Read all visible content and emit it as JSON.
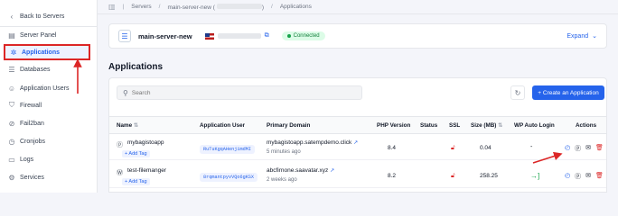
{
  "sidebar": {
    "items": [
      {
        "label": "Back to Servers",
        "icon": "chevron-left-icon",
        "glyph": "‹"
      },
      {
        "label": "Server Panel",
        "icon": "server-panel-icon",
        "glyph": "▤"
      },
      {
        "label": "Applications",
        "icon": "applications-icon",
        "glyph": "✲"
      },
      {
        "label": "Databases",
        "icon": "database-icon",
        "glyph": "☰"
      },
      {
        "label": "Application Users",
        "icon": "users-icon",
        "glyph": "☺"
      },
      {
        "label": "Firewall",
        "icon": "shield-icon",
        "glyph": "⛉"
      },
      {
        "label": "Fail2ban",
        "icon": "ban-icon",
        "glyph": "⊘"
      },
      {
        "label": "Cronjobs",
        "icon": "clock-icon",
        "glyph": "◷"
      },
      {
        "label": "Logs",
        "icon": "logs-icon",
        "glyph": "▭"
      },
      {
        "label": "Services",
        "icon": "services-icon",
        "glyph": "⚙"
      }
    ]
  },
  "breadcrumb": {
    "items": [
      "Servers",
      "main-server-new (",
      ")",
      "Applications"
    ]
  },
  "server": {
    "name": "main-server-new",
    "status": "Connected",
    "expand_label": "Expand"
  },
  "applications": {
    "title": "Applications",
    "search_placeholder": "Search",
    "create_label": "+ Create an Application",
    "columns": [
      "Name",
      "Application User",
      "Primary Domain",
      "PHP Version",
      "Status",
      "SSL",
      "Size (MB)",
      "WP Auto Login",
      "Actions"
    ],
    "rows": [
      {
        "name": "mybagistoapp",
        "add_tag": "+ Add Tag",
        "user": "RuTuKgqAHenjimdMI",
        "domain": "mybagistoapp.satempdemo.click",
        "time": "5 minutes ago",
        "php": "8.4",
        "size": "0.04",
        "wp_auto_login": "-"
      },
      {
        "name": "test-filemanger",
        "add_tag": "+ Add Tag",
        "user": "8rqmantpyvVQo6gKSX",
        "domain": "abcfirnone.saavatar.xyz",
        "time": "2 weeks ago",
        "php": "8.2",
        "size": "258.25",
        "wp_auto_login": "→]"
      }
    ]
  },
  "colors": {
    "accent": "#2563eb",
    "annotation": "#dc2626",
    "connected": "#15803d"
  }
}
